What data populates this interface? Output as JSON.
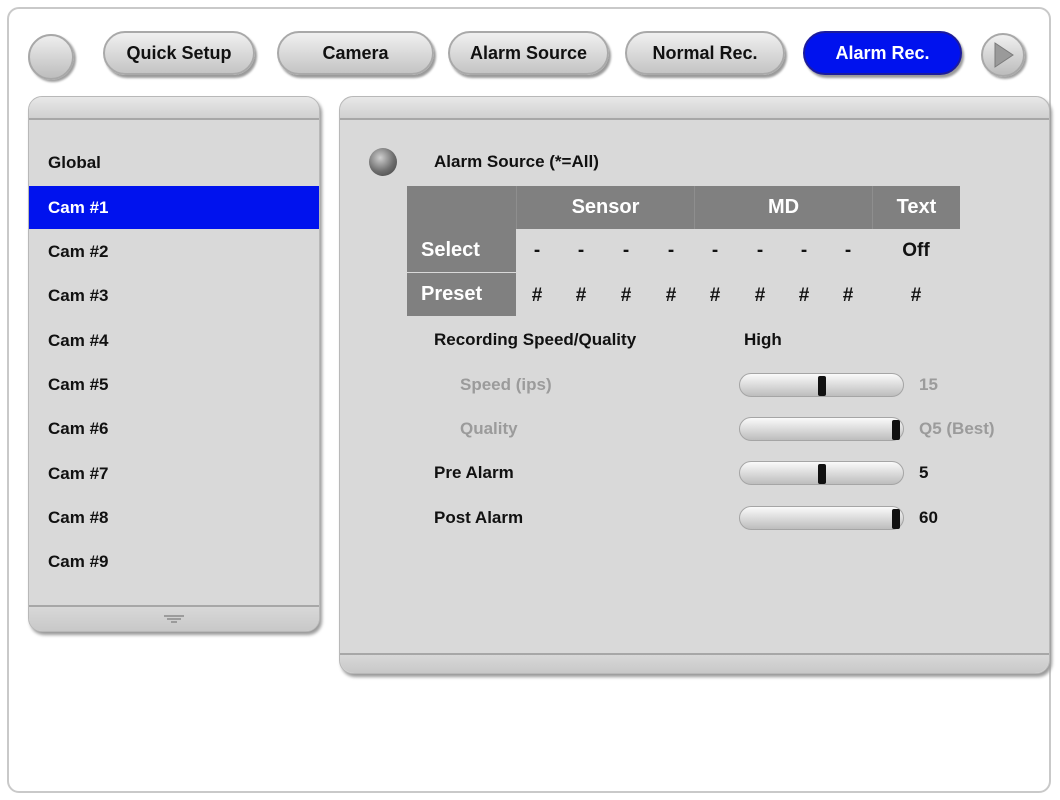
{
  "tabs": [
    {
      "label": "Quick Setup",
      "active": false
    },
    {
      "label": "Camera",
      "active": false
    },
    {
      "label": "Alarm Source",
      "active": false
    },
    {
      "label": "Normal Rec.",
      "active": false
    },
    {
      "label": "Alarm Rec.",
      "active": true
    }
  ],
  "sidebar": {
    "items": [
      {
        "label": "Global",
        "active": false
      },
      {
        "label": "Cam #1",
        "active": true
      },
      {
        "label": "Cam #2",
        "active": false
      },
      {
        "label": "Cam #3",
        "active": false
      },
      {
        "label": "Cam #4",
        "active": false
      },
      {
        "label": "Cam #5",
        "active": false
      },
      {
        "label": "Cam #6",
        "active": false
      },
      {
        "label": "Cam #7",
        "active": false
      },
      {
        "label": "Cam #8",
        "active": false
      },
      {
        "label": "Cam #9",
        "active": false
      }
    ]
  },
  "main": {
    "section_title": "Alarm Source (*=All)",
    "table": {
      "headers": {
        "sensor": "Sensor",
        "md": "MD",
        "text": "Text"
      },
      "rows": [
        {
          "label": "Select",
          "sensor": [
            "-",
            "-",
            "-",
            "-"
          ],
          "md": [
            "-",
            "-",
            "-",
            "-"
          ],
          "text": "Off"
        },
        {
          "label": "Preset",
          "sensor": [
            "#",
            "#",
            "#",
            "#"
          ],
          "md": [
            "#",
            "#",
            "#",
            "#"
          ],
          "text": "#"
        }
      ]
    },
    "recording": {
      "label": "Recording Speed/Quality",
      "value": "High"
    },
    "sliders": [
      {
        "label": "Speed (ips)",
        "value_text": "15",
        "level": 0.5,
        "disabled": true
      },
      {
        "label": "Quality",
        "value_text": "Q5 (Best)",
        "level": 1.0,
        "disabled": true
      },
      {
        "label": "Pre Alarm",
        "value_text": "5",
        "level": 0.5,
        "disabled": false
      },
      {
        "label": "Post Alarm",
        "value_text": "60",
        "level": 1.0,
        "disabled": false
      }
    ]
  },
  "colors": {
    "accent": "#0012ee",
    "table_header": "#808080",
    "panel": "#d9d9d9",
    "disabled_text": "#9b9b9b"
  },
  "icons": {
    "next": "play-triangle-icon",
    "section": "sphere-bullet-icon",
    "scroll": "scroll-down-grip-icon"
  }
}
